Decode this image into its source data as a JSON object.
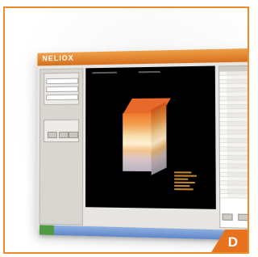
{
  "app": {
    "logo_text": "NELIOX"
  },
  "badge": {
    "letter": "D"
  },
  "colors": {
    "frame_border": "#f08a2a",
    "badge_bg": "#e8731e",
    "app_header": "#d46f1c",
    "viewport_bg": "#000000",
    "taskbar": "#5f86c9"
  },
  "icons": {
    "model": "3d-block-model-icon",
    "start": "start-button-icon"
  }
}
